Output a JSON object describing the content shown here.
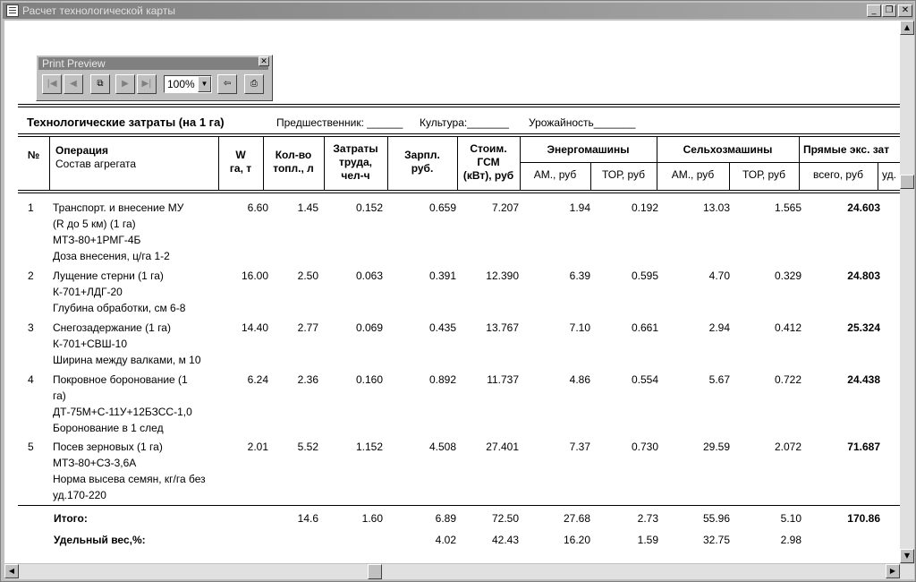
{
  "window": {
    "title": "Расчет технологической карты"
  },
  "print_preview": {
    "title": "Print Preview",
    "zoom": "100%"
  },
  "report": {
    "heading": "Технологические затраты (на 1 га)",
    "predecessor": "Предшественник: ______",
    "crop": "Культура:_______",
    "yield": "Урожайность_______"
  },
  "table": {
    "headers": {
      "num": "№",
      "operation_1": "Операция",
      "operation_2": "Состав агрегата",
      "w_1": "W",
      "w_2": "га, т",
      "fuel_1": "Кол-во",
      "fuel_2": "топл., л",
      "labor_1": "Затраты",
      "labor_2": "труда,",
      "labor_3": "чел-ч",
      "wage_1": "Зарпл.",
      "wage_2": "руб.",
      "gsm_1": "Стоим.",
      "gsm_2": "ГСМ",
      "gsm_3": "(кВт), руб",
      "energy": "Энергомашины",
      "agri": "Сельхозмашины",
      "direct": "Прямые экс. зат",
      "am": "АМ., руб",
      "tor": "ТОР, руб",
      "total": "всего, руб",
      "ud": "уд."
    },
    "rows": [
      {
        "num": "1",
        "lines": [
          "Транспорт. и внесение МУ",
          "(R до 5 км)  (1 га)",
          "МТЗ-80+1РМГ-4Б",
          "Доза внесения, ц/га  1-2"
        ],
        "w": "6.60",
        "fuel": "1.45",
        "labor": "0.152",
        "wage": "0.659",
        "gsm": "7.207",
        "e_am": "1.94",
        "e_tor": "0.192",
        "a_am": "13.03",
        "a_tor": "1.565",
        "total": "24.603"
      },
      {
        "num": "2",
        "lines": [
          "Лущение стерни  (1 га)",
          "К-701+ЛДГ-20",
          "Глубина обработки, см  6-8"
        ],
        "w": "16.00",
        "fuel": "2.50",
        "labor": "0.063",
        "wage": "0.391",
        "gsm": "12.390",
        "e_am": "6.39",
        "e_tor": "0.595",
        "a_am": "4.70",
        "a_tor": "0.329",
        "total": "24.803"
      },
      {
        "num": "3",
        "lines": [
          "Снегозадержание  (1 га)",
          "К-701+СВШ-10",
          "Ширина между валками, м  10"
        ],
        "w": "14.40",
        "fuel": "2.77",
        "labor": "0.069",
        "wage": "0.435",
        "gsm": "13.767",
        "e_am": "7.10",
        "e_tor": "0.661",
        "a_am": "2.94",
        "a_tor": "0.412",
        "total": "25.324"
      },
      {
        "num": "4",
        "lines": [
          "Покровное боронование  (1",
          "га)",
          "ДТ-75М+С-11У+12БЗСС-1,0",
          "Боронование  в 1 след"
        ],
        "w": "6.24",
        "fuel": "2.36",
        "labor": "0.160",
        "wage": "0.892",
        "gsm": "11.737",
        "e_am": "4.86",
        "e_tor": "0.554",
        "a_am": "5.67",
        "a_tor": "0.722",
        "total": "24.438"
      },
      {
        "num": "5",
        "lines": [
          "Посев зерновых  (1 га)",
          "МТЗ-80+СЗ-3,6А",
          "Норма высева семян, кг/га  без",
          "уд.170-220"
        ],
        "w": "2.01",
        "fuel": "5.52",
        "labor": "1.152",
        "wage": "4.508",
        "gsm": "27.401",
        "e_am": "7.37",
        "e_tor": "0.730",
        "a_am": "29.59",
        "a_tor": "2.072",
        "total": "71.687"
      }
    ],
    "totals": {
      "label": "Итого:",
      "fuel": "14.6",
      "labor": "1.60",
      "wage": "6.89",
      "gsm": "72.50",
      "e_am": "27.68",
      "e_tor": "2.73",
      "a_am": "55.96",
      "a_tor": "5.10",
      "total": "170.86"
    },
    "share": {
      "label": "Удельный вес,%:",
      "wage": "4.02",
      "gsm": "42.43",
      "e_am": "16.20",
      "e_tor": "1.59",
      "a_am": "32.75",
      "a_tor": "2.98"
    }
  }
}
